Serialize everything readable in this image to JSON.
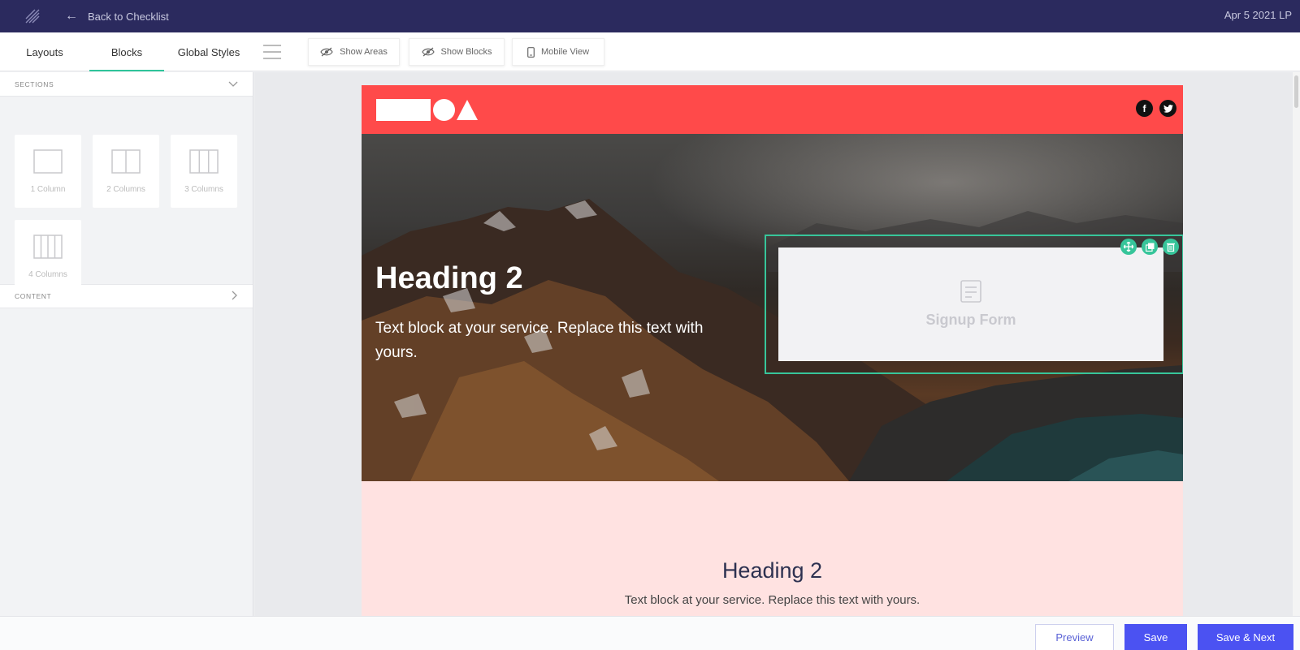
{
  "topbar": {
    "back_label": "Back to Checklist",
    "doc_title": "Apr 5 2021 LP"
  },
  "tabs": [
    {
      "label": "Layouts",
      "active": false
    },
    {
      "label": "Blocks",
      "active": true
    },
    {
      "label": "Global Styles",
      "active": false
    }
  ],
  "toolbar": {
    "show_areas": "Show Areas",
    "show_blocks": "Show Blocks",
    "mobile_view": "Mobile View"
  },
  "sidebar": {
    "sections_label": "SECTIONS",
    "content_label": "CONTENT",
    "cards": [
      {
        "label": "1 Column",
        "icon": "one-column-icon"
      },
      {
        "label": "2 Columns",
        "icon": "two-columns-icon"
      },
      {
        "label": "3 Columns",
        "icon": "three-columns-icon"
      },
      {
        "label": "4 Columns",
        "icon": "four-columns-icon"
      }
    ]
  },
  "page": {
    "header_color": "#ff4a4a",
    "social": [
      "f",
      "twitter-icon"
    ],
    "hero": {
      "heading": "Heading 2",
      "text": "Text block at your service. Replace this text with yours."
    },
    "signup": {
      "label": "Signup Form"
    },
    "section2": {
      "heading": "Heading 2",
      "text": "Text block at your service. Replace this text with yours."
    }
  },
  "bottombar": {
    "preview": "Preview",
    "save": "Save",
    "save_next": "Save & Next"
  },
  "colors": {
    "accent": "#2fc49a",
    "primary": "#4b52f2",
    "topbar": "#2b2a5e",
    "pink_section": "#ffe2e1"
  }
}
